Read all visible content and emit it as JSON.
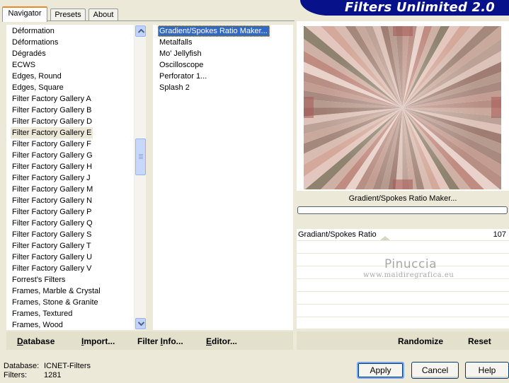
{
  "tabs": [
    {
      "label": "Navigator",
      "active": true
    },
    {
      "label": "Presets",
      "active": false
    },
    {
      "label": "About",
      "active": false
    }
  ],
  "banner": {
    "title": "Filters Unlimited 2.0"
  },
  "categories": {
    "items": [
      "Déformation",
      "Déformations",
      "Dégradés",
      "ECWS",
      "Edges, Round",
      "Edges, Square",
      "Filter Factory Gallery A",
      "Filter Factory Gallery B",
      "Filter Factory Gallery D",
      "Filter Factory Gallery E",
      "Filter Factory Gallery F",
      "Filter Factory Gallery G",
      "Filter Factory Gallery H",
      "Filter Factory Gallery J",
      "Filter Factory Gallery M",
      "Filter Factory Gallery N",
      "Filter Factory Gallery P",
      "Filter Factory Gallery Q",
      "Filter Factory Gallery S",
      "Filter Factory Gallery T",
      "Filter Factory Gallery U",
      "Filter Factory Gallery V",
      "Forrest's Filters",
      "Frames, Marble & Crystal",
      "Frames, Stone & Granite",
      "Frames, Textured",
      "Frames, Wood"
    ],
    "selected": "Filter Factory Gallery E"
  },
  "filters": {
    "items": [
      "Gradient/Spokes Ratio Maker...",
      "Metalfalls",
      "Mo' Jellyfish",
      "Oscilloscope",
      "Perforator 1...",
      "Splash 2"
    ],
    "selected": "Gradient/Spokes Ratio Maker..."
  },
  "preview": {
    "filter_name": "Gradient/Spokes Ratio Maker..."
  },
  "params": [
    {
      "label": "Gradiant/Spokes Ratio",
      "value": "107"
    }
  ],
  "watermark": {
    "name": "Pinuccia",
    "site": "www.maidiregrafica.eu"
  },
  "toolbar": {
    "database": "Database",
    "import": "Import...",
    "filter_info": "Filter Info...",
    "editor": "Editor...",
    "randomize": "Randomize",
    "reset": "Reset"
  },
  "status": {
    "database_label": "Database:",
    "database_value": "ICNET-Filters",
    "filters_label": "Filters:",
    "filters_value": "1281"
  },
  "buttons": {
    "apply": "Apply",
    "cancel": "Cancel",
    "help": "Help"
  },
  "colors": {
    "banner": "#06118a",
    "selection": "#316ac5",
    "tab_accent": "#e68b2c"
  }
}
